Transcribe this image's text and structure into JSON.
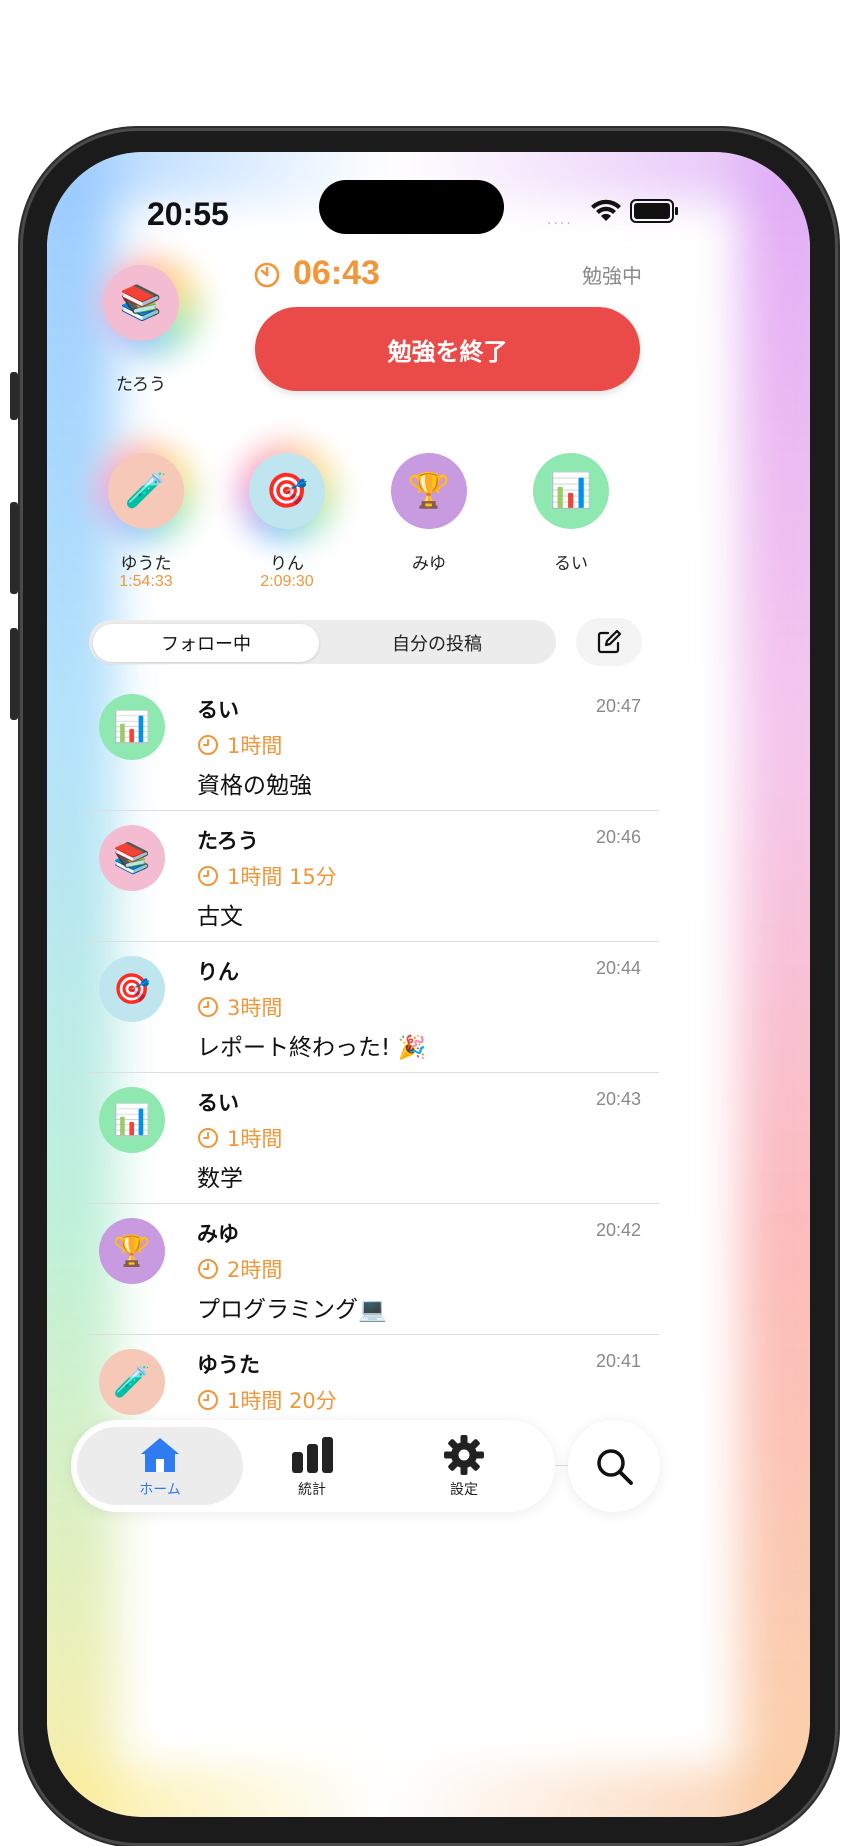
{
  "status_bar": {
    "time": "20:55",
    "signal": "....",
    "icons": [
      "wifi-icon",
      "battery-icon"
    ]
  },
  "me": {
    "name": "たろう",
    "emoji": "📚",
    "avatar_color": "#f3bcd0"
  },
  "session": {
    "timer": "06:43",
    "status": "勉強中",
    "end_button": "勉強を終了",
    "accent": "#f0973b",
    "button_color": "#ea4b48"
  },
  "friends": [
    {
      "name": "ゆうた",
      "emoji": "🧪",
      "elapsed": "1:54:33",
      "color": "#f6c8b8"
    },
    {
      "name": "りん",
      "emoji": "🎯",
      "elapsed": "2:09:30",
      "color": "#bfe6ee"
    },
    {
      "name": "みゆ",
      "emoji": "🏆",
      "elapsed": "",
      "color": "#c89adf"
    },
    {
      "name": "るい",
      "emoji": "📊",
      "elapsed": "",
      "color": "#8ee8b0"
    }
  ],
  "segments": {
    "following": "フォロー中",
    "mine": "自分の投稿",
    "selected": "following"
  },
  "posts": [
    {
      "name": "るい",
      "emoji": "📊",
      "color": "#8ee8b0",
      "time": "20:47",
      "duration": "1時間",
      "text": "資格の勉強"
    },
    {
      "name": "たろう",
      "emoji": "📚",
      "color": "#f3bcd0",
      "time": "20:46",
      "duration": "1時間 15分",
      "text": "古文"
    },
    {
      "name": "りん",
      "emoji": "🎯",
      "color": "#bfe6ee",
      "time": "20:44",
      "duration": "3時間",
      "text": "レポート終わった! 🎉"
    },
    {
      "name": "るい",
      "emoji": "📊",
      "color": "#8ee8b0",
      "time": "20:43",
      "duration": "1時間",
      "text": "数学"
    },
    {
      "name": "みゆ",
      "emoji": "🏆",
      "color": "#c89adf",
      "time": "20:42",
      "duration": "2時間",
      "text": "プログラミング💻"
    },
    {
      "name": "ゆうた",
      "emoji": "🧪",
      "color": "#f6c8b8",
      "time": "20:41",
      "duration": "1時間 20分",
      "text": ""
    }
  ],
  "tabs": [
    {
      "id": "home",
      "label": "ホーム",
      "icon": "house-icon",
      "active": true
    },
    {
      "id": "stats",
      "label": "統計",
      "icon": "bar-chart-icon",
      "active": false
    },
    {
      "id": "settings",
      "label": "設定",
      "icon": "gear-icon",
      "active": false
    }
  ],
  "search": {
    "icon": "search-icon"
  },
  "colors": {
    "active_tab": "#2f7bf2"
  }
}
